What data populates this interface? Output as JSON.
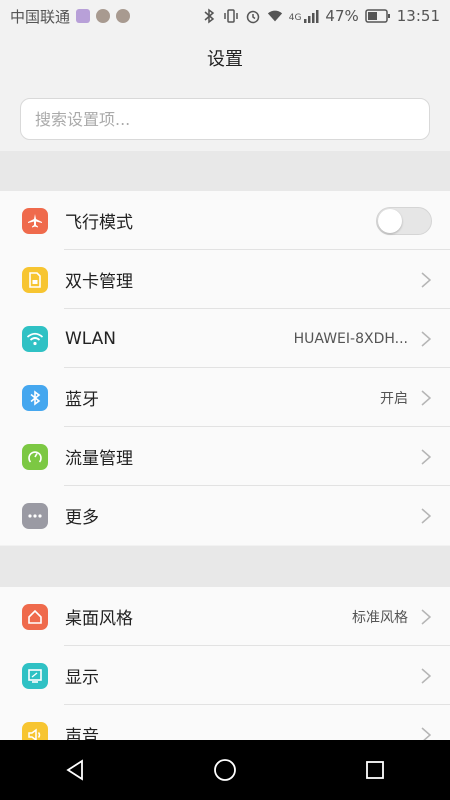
{
  "status_bar": {
    "carrier": "中国联通",
    "battery": "47%",
    "time": "13:51",
    "network": "4G"
  },
  "header": {
    "title": "设置"
  },
  "search": {
    "placeholder": "搜索设置项..."
  },
  "groups": [
    {
      "items": [
        {
          "label": "飞行模式",
          "icon": "airplane-icon",
          "color": "#ef6a4c",
          "toggle": false
        },
        {
          "label": "双卡管理",
          "icon": "sim-card-icon",
          "color": "#f7c531"
        },
        {
          "label": "WLAN",
          "icon": "wifi-icon",
          "color": "#2fc1c4",
          "value": "HUAWEI-8XDH..."
        },
        {
          "label": "蓝牙",
          "icon": "bluetooth-icon",
          "color": "#45a7ef",
          "value": "开启"
        },
        {
          "label": "流量管理",
          "icon": "data-usage-icon",
          "color": "#7cc843"
        },
        {
          "label": "更多",
          "icon": "more-icon",
          "color": "#9a9aa3"
        }
      ]
    },
    {
      "items": [
        {
          "label": "桌面风格",
          "icon": "home-icon",
          "color": "#ef6a4c",
          "value": "标准风格"
        },
        {
          "label": "显示",
          "icon": "display-icon",
          "color": "#2fc1c4"
        },
        {
          "label": "声音",
          "icon": "sound-icon",
          "color": "#f7c531"
        }
      ]
    }
  ]
}
